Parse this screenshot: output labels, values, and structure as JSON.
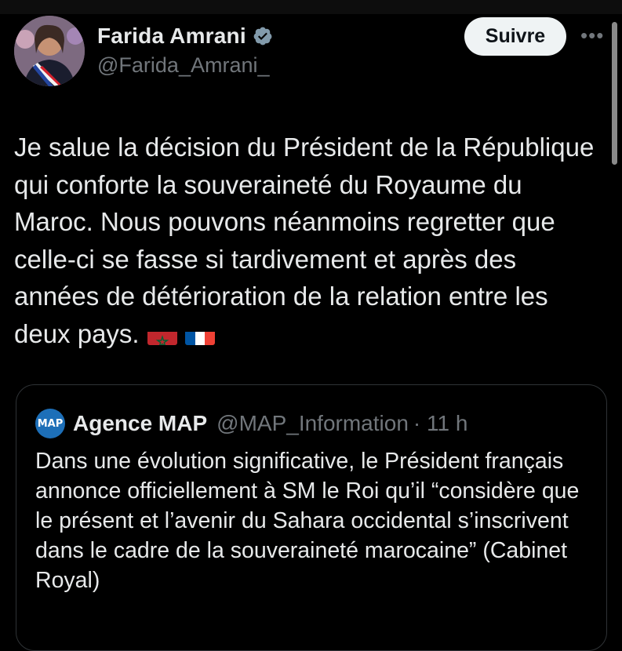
{
  "author": {
    "name": "Farida Amrani",
    "handle": "@Farida_Amrani_",
    "verified": true
  },
  "follow_label": "Suivre",
  "more_label": "•••",
  "tweet": {
    "text": "Je salue la décision du Président de la République qui conforte la souveraineté du Royaume du Maroc. Nous pouvons néanmoins regretter que celle-ci se fasse si tardivement et après des années de détérioration de la relation entre les deux pays.",
    "emojis": [
      "flag-morocco-icon",
      "flag-france-icon"
    ]
  },
  "quoted_tweet": {
    "logo_text": "MAP",
    "name": "Agence MAP",
    "handle": "@MAP_Information",
    "time": "· 11 h",
    "text": "Dans une évolution significative, le Président français annonce officiellement à SM le Roi qu’il “considère que le présent et l’avenir du Sahara occidental s’inscrivent dans le cadre de la souveraineté marocaine” (Cabinet Royal)"
  },
  "colors": {
    "background": "#000000",
    "text": "#e7e9ea",
    "secondary": "#71767b",
    "verified": "#829aab",
    "button_bg": "#eff3f4"
  }
}
